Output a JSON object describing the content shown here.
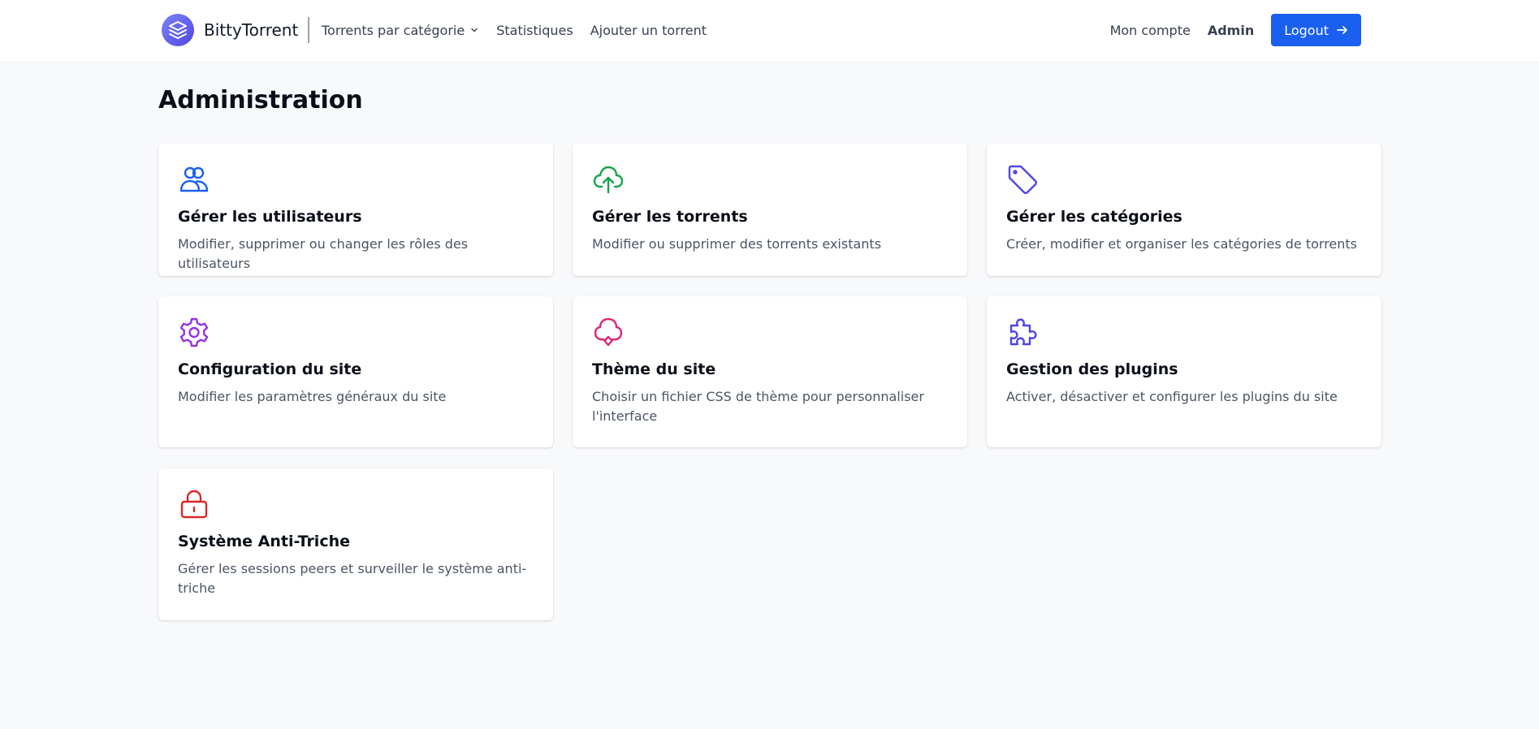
{
  "header": {
    "brand": "BittyTorrent",
    "nav": {
      "categories": "Torrents par catégorie",
      "stats": "Statistiques",
      "add": "Ajouter un torrent"
    },
    "account": "Mon compte",
    "admin": "Admin",
    "logout": "Logout",
    "accent_color": "#1a5ff0"
  },
  "page": {
    "title": "Administration"
  },
  "cards": [
    {
      "icon": "users-icon",
      "color": "#1a5ff0",
      "title": "Gérer les utilisateurs",
      "desc": "Modifier, supprimer ou changer les rôles des utilisateurs"
    },
    {
      "icon": "cloud-upload-icon",
      "color": "#16a34a",
      "title": "Gérer les torrents",
      "desc": "Modifier ou supprimer des torrents existants"
    },
    {
      "icon": "tag-icon",
      "color": "#4f46e5",
      "title": "Gérer les catégories",
      "desc": "Créer, modifier et organiser les catégories de torrents"
    },
    {
      "icon": "gear-icon",
      "color": "#9333ea",
      "title": "Configuration du site",
      "desc": "Modifier les paramètres généraux du site"
    },
    {
      "icon": "palette-icon",
      "color": "#db2777",
      "title": "Thème du site",
      "desc": "Choisir un fichier CSS de thème pour personnaliser l'interface"
    },
    {
      "icon": "puzzle-icon",
      "color": "#4f46e5",
      "title": "Gestion des plugins",
      "desc": "Activer, désactiver et configurer les plugins du site"
    },
    {
      "icon": "lock-icon",
      "color": "#dc2626",
      "title": "Système Anti-Triche",
      "desc": "Gérer les sessions peers et surveiller le système anti-triche"
    }
  ]
}
